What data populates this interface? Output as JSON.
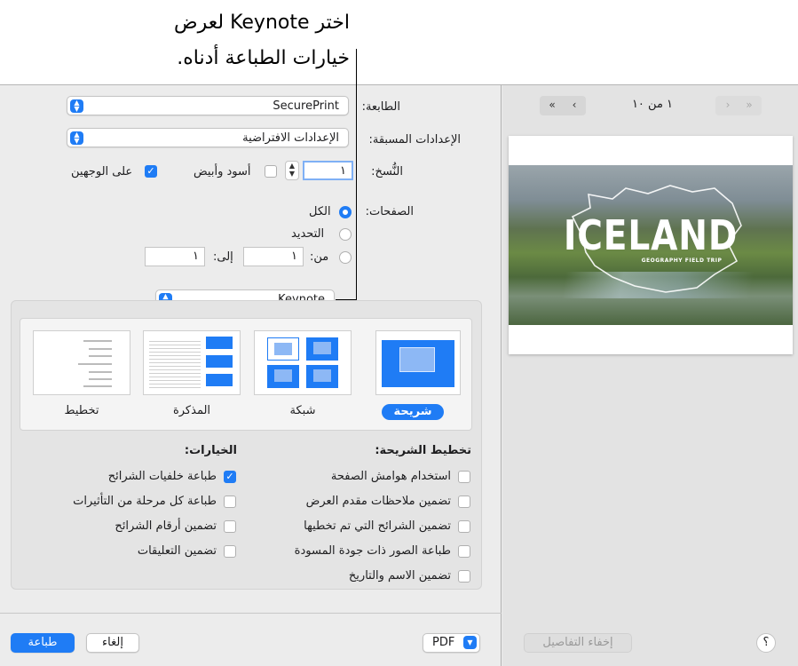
{
  "callout": {
    "line1": "اختر Keynote لعرض",
    "line2": "خيارات الطباعة أدناه."
  },
  "print": {
    "printer_label": "الطابعة:",
    "printer_value": "SecurePrint",
    "presets_label": "الإعدادات المسبقة:",
    "presets_value": "الإعدادات الافتراضية",
    "copies_label": "النُّسخ:",
    "copies_value": "١",
    "bw_label": "أسود وأبيض",
    "bw_checked": false,
    "duplex_label": "على الوجهين",
    "duplex_checked": true,
    "pages_label": "الصفحات:",
    "pages_all": "الكل",
    "pages_selection": "التحديد",
    "pages_from": "من:",
    "pages_from_value": "١",
    "pages_to": "إلى:",
    "pages_to_value": "١",
    "pages_selected": "all",
    "app_menu_value": "Keynote"
  },
  "keynote": {
    "layouts": [
      {
        "label": "شريحة",
        "selected": true
      },
      {
        "label": "شبكة",
        "selected": false
      },
      {
        "label": "المذكرة",
        "selected": false
      },
      {
        "label": "تخطيط",
        "selected": false
      }
    ],
    "slide_layout_head": "تخطيط الشريحة:",
    "slide_layout_options": [
      {
        "label": "استخدام هوامش الصفحة",
        "checked": false
      },
      {
        "label": "تضمين ملاحظات مقدم العرض",
        "checked": false
      },
      {
        "label": "تضمين الشرائح التي تم تخطيها",
        "checked": false
      },
      {
        "label": "طباعة الصور ذات جودة المسودة",
        "checked": false
      },
      {
        "label": "تضمين الاسم والتاريخ",
        "checked": false
      }
    ],
    "options_head": "الخيارات:",
    "options": [
      {
        "label": "طباعة خلفيات الشرائح",
        "checked": true
      },
      {
        "label": "طباعة كل مرحلة من التأثيرات",
        "checked": false
      },
      {
        "label": "تضمين أرقام الشرائح",
        "checked": false
      },
      {
        "label": "تضمين التعليقات",
        "checked": false
      }
    ]
  },
  "preview": {
    "page_indicator": "١ من ١٠",
    "slide_title": "ICELAND",
    "slide_subtitle": "GEOGRAPHY FIELD TRIP",
    "hide_details": "إخفاء التفاصيل",
    "help": "؟"
  },
  "footer": {
    "pdf_label": "PDF",
    "cancel": "إلغاء",
    "print": "طباعة"
  },
  "colors": {
    "accent": "#1f7cf5",
    "panel": "#ececec"
  }
}
